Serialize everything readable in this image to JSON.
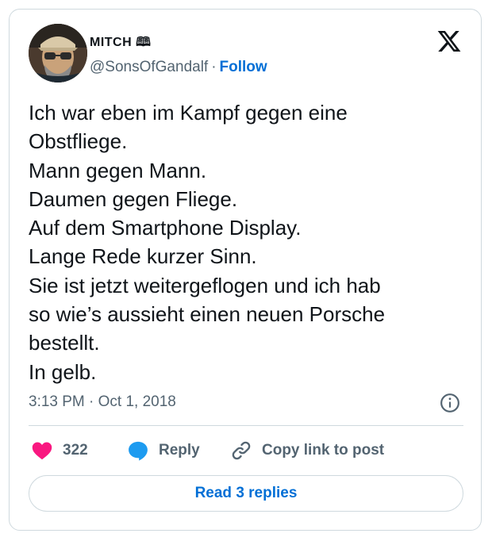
{
  "author": {
    "name": "MITCH 🕮",
    "handle": "@SonsOfGandalf",
    "separator": "·",
    "follow_label": "Follow"
  },
  "tweet": {
    "lines": [
      "Ich war eben im Kampf gegen eine",
      "Obstfliege.",
      "Mann gegen Mann.",
      "Daumen gegen Fliege.",
      "Auf dem Smartphone Display.",
      "Lange Rede kurzer Sinn.",
      "Sie ist jetzt weitergeflogen und ich hab",
      "so wie’s aussieht einen neuen Porsche",
      "bestellt.",
      "In gelb."
    ],
    "timestamp": "3:13 PM · Oct 1, 2018"
  },
  "actions": {
    "likes_count": "322",
    "reply_label": "Reply",
    "copy_label": "Copy link to post"
  },
  "read_replies_label": "Read 3 replies",
  "colors": {
    "accent": "#006fd6",
    "heart": "#f91880",
    "reply_bubble": "#1d9bf0",
    "muted": "#536471",
    "text": "#0f1419",
    "border": "#cfd9de"
  },
  "icons": [
    "x-logo-icon",
    "info-icon",
    "heart-icon",
    "reply-bubble-icon",
    "link-icon"
  ]
}
